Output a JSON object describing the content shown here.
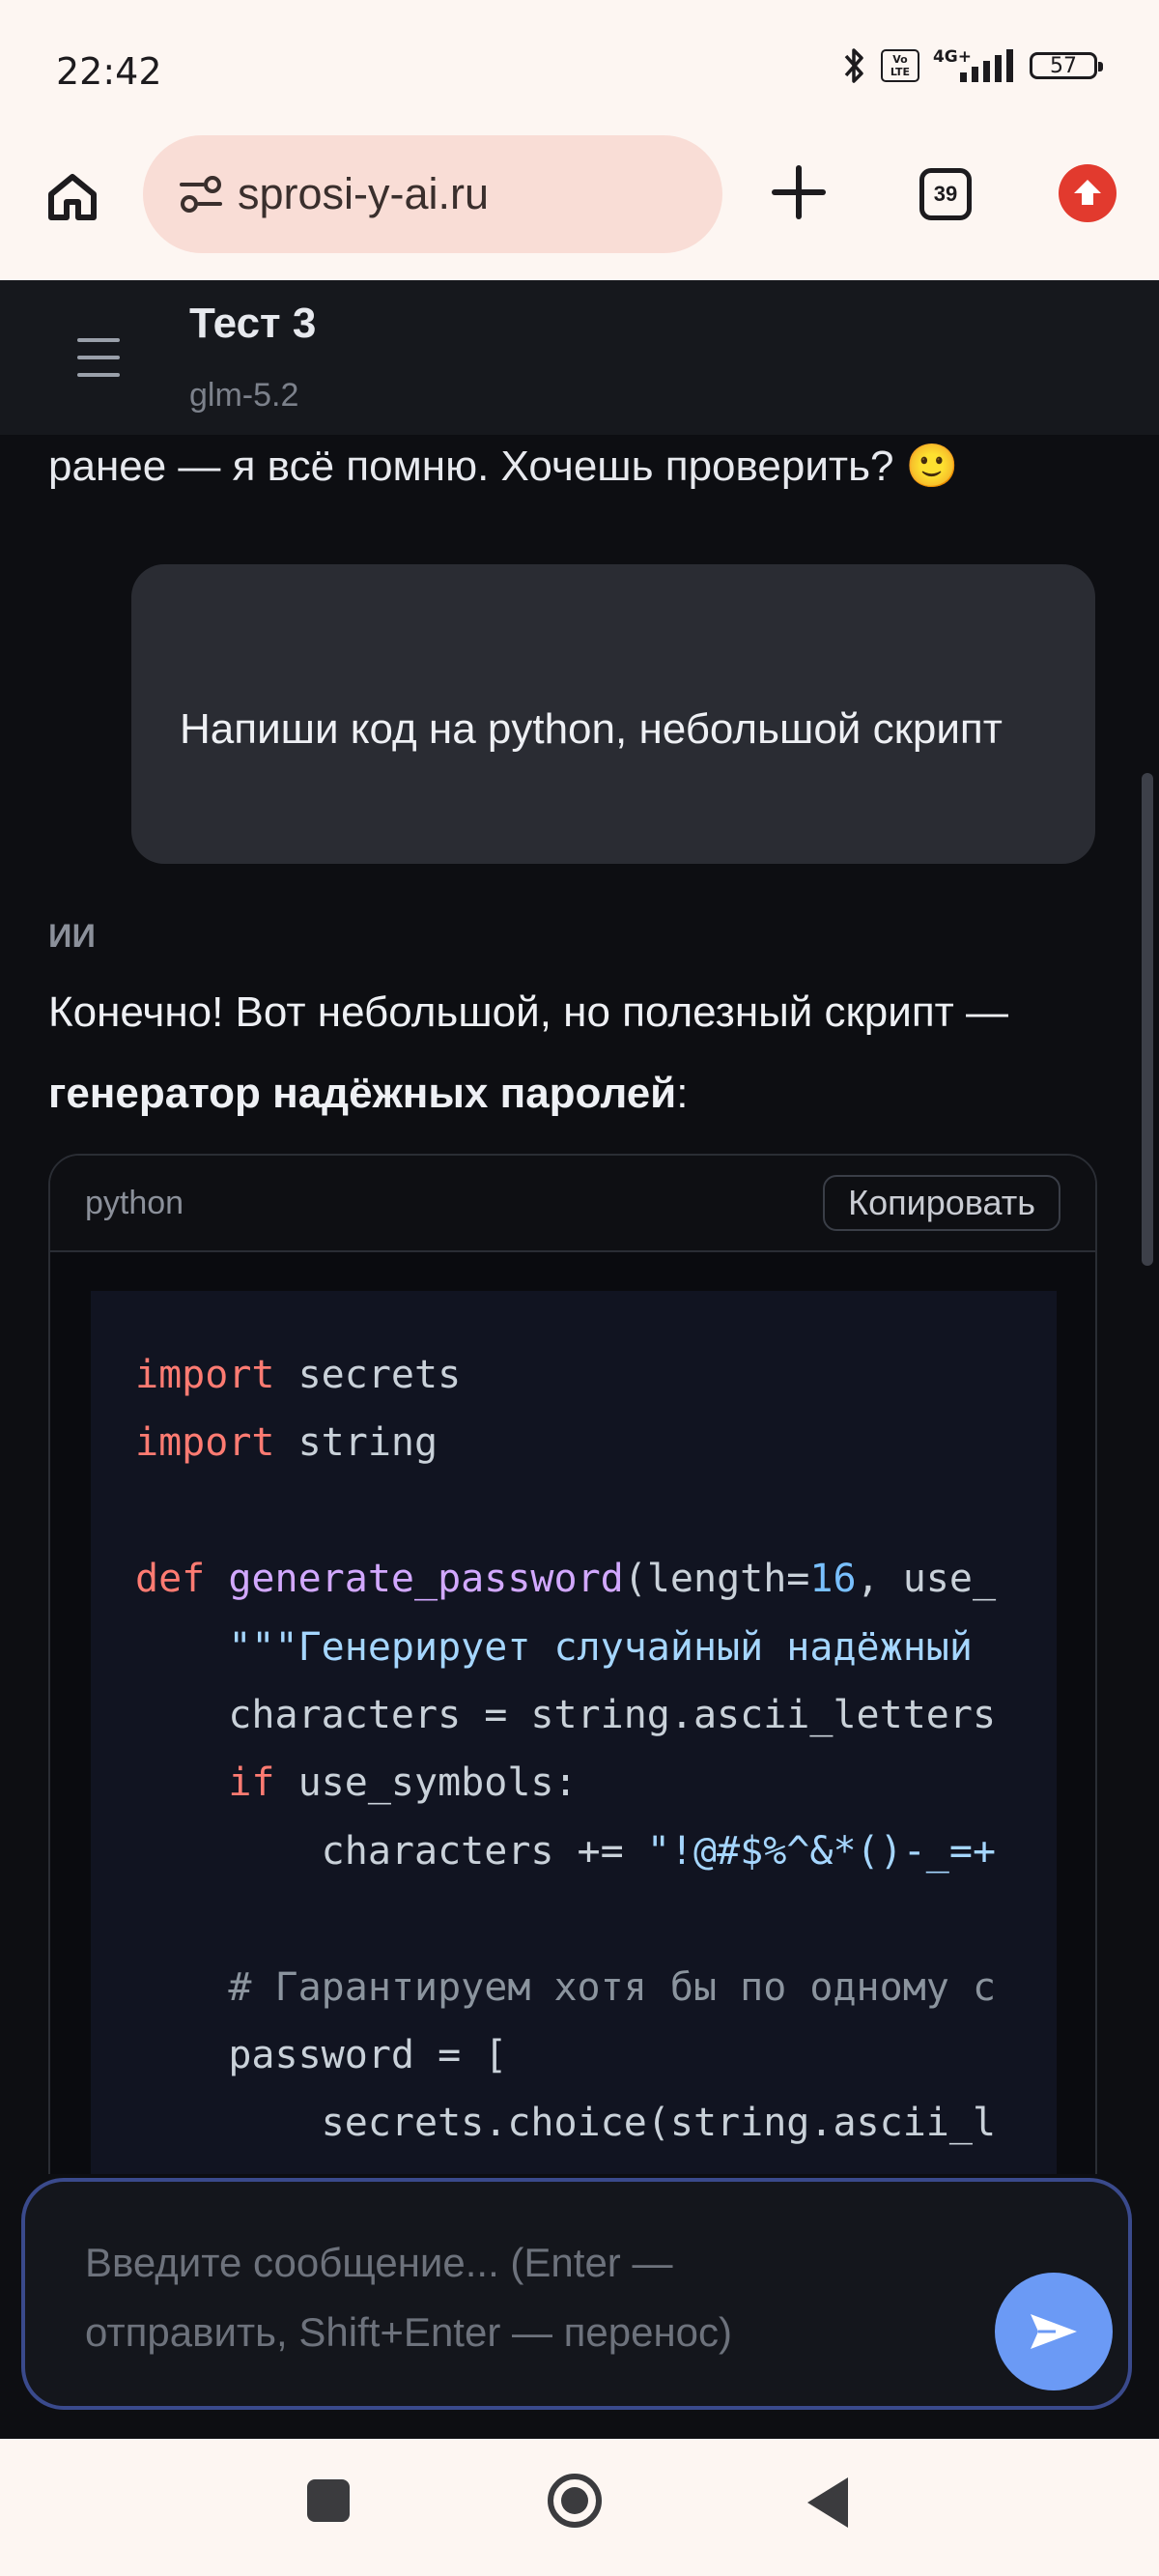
{
  "status_bar": {
    "time": "22:42",
    "volte": "Vo LTE",
    "network": "4G+",
    "battery": "57"
  },
  "browser": {
    "url": "sprosi-y-ai.ru",
    "tabs_count": "39",
    "icons": {
      "home": "home-icon",
      "site_settings": "tune-icon",
      "new_tab": "plus-icon",
      "update": "arrow-up-icon"
    },
    "accent_update": "#e23a2e"
  },
  "chat": {
    "title": "Тест 3",
    "model": "glm-5.2",
    "prev_message_tail": "ранее — я всё помню. Хочешь проверить? 🙂",
    "user_message": "Напиши код на python, небольшой скрипт",
    "ai_label": "ИИ",
    "ai_text_before": "Конечно! Вот небольшой, но полезный скрипт — ",
    "ai_text_bold": "генератор надёжных паролей",
    "ai_text_after": ":",
    "code": {
      "language": "python",
      "copy_label": "Копировать",
      "lines": [
        [
          [
            "kw",
            "import"
          ],
          [
            "",
            "  secrets"
          ]
        ],
        [
          [
            "kw",
            "import"
          ],
          [
            "",
            "  string"
          ]
        ],
        [],
        [
          [
            "kw",
            "def"
          ],
          [
            "",
            ""
          ],
          [
            "fn",
            " generate_password"
          ],
          [
            "",
            "(length="
          ],
          [
            "num",
            "16"
          ],
          [
            "",
            ", use_"
          ]
        ],
        [
          [
            "",
            "    "
          ],
          [
            "str",
            "\"\"\"Генерирует случайный надёжный"
          ]
        ],
        [
          [
            "",
            "    characters = string.ascii_letters"
          ]
        ],
        [
          [
            "",
            "    "
          ],
          [
            "kw",
            "if"
          ],
          [
            "",
            " use_symbols:"
          ]
        ],
        [
          [
            "",
            "        characters += "
          ],
          [
            "str",
            "\"!@#$%^&*()-_=+"
          ]
        ],
        [],
        [
          [
            "",
            "    "
          ],
          [
            "cm",
            "# Гарантируем хотя бы по одному с"
          ]
        ],
        [
          [
            "",
            "    password = ["
          ]
        ],
        [
          [
            "",
            "        secrets.choice(string.ascii_l"
          ]
        ]
      ]
    }
  },
  "composer": {
    "placeholder": "Введите сообщение... (Enter — отправить, Shift+Enter — перенос)",
    "send_icon": "send-icon",
    "send_color": "#6b9af5"
  },
  "nav": {
    "icons": {
      "recents": "recents-square-icon",
      "home": "home-circle-icon",
      "back": "back-triangle-icon"
    }
  }
}
